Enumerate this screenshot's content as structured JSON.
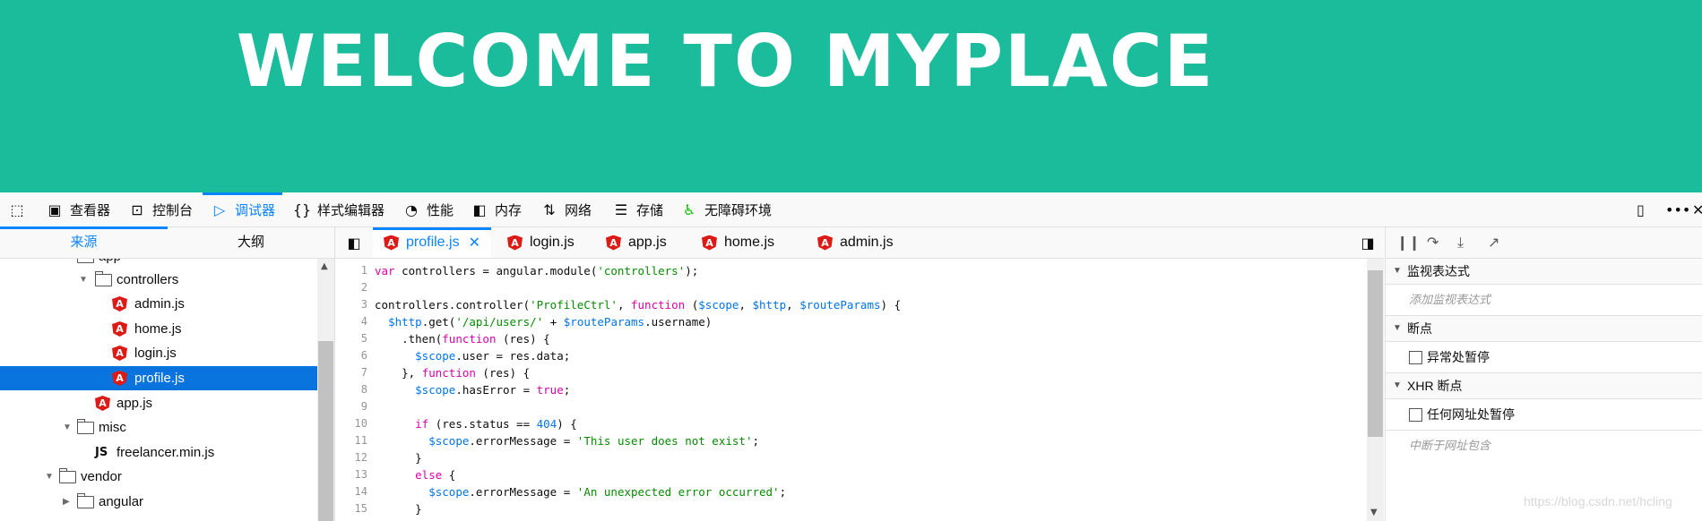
{
  "banner": {
    "title": "WELCOME TO MYPLACE"
  },
  "colors": {
    "banner_bg": "#1abc9c",
    "accent": "#0a84ff",
    "selection": "#0a74de"
  },
  "toolbar": {
    "items": [
      {
        "label": "查看器",
        "icon": "inspector-icon"
      },
      {
        "label": "控制台",
        "icon": "console-icon"
      },
      {
        "label": "调试器",
        "icon": "debugger-icon",
        "active": true
      },
      {
        "label": "样式编辑器",
        "icon": "style-editor-icon"
      },
      {
        "label": "性能",
        "icon": "performance-icon"
      },
      {
        "label": "内存",
        "icon": "memory-icon"
      },
      {
        "label": "网络",
        "icon": "network-icon"
      },
      {
        "label": "存储",
        "icon": "storage-icon"
      },
      {
        "label": "无障碍环境",
        "icon": "accessibility-icon"
      }
    ]
  },
  "sources": {
    "tabs": [
      "来源",
      "大纲"
    ],
    "tree": [
      {
        "label": "app",
        "type": "folder",
        "open": true
      },
      {
        "label": "controllers",
        "type": "folder",
        "open": true
      },
      {
        "label": "admin.js",
        "type": "angular"
      },
      {
        "label": "home.js",
        "type": "angular"
      },
      {
        "label": "login.js",
        "type": "angular"
      },
      {
        "label": "profile.js",
        "type": "angular",
        "selected": true
      },
      {
        "label": "app.js",
        "type": "angular"
      },
      {
        "label": "misc",
        "type": "folder",
        "open": true
      },
      {
        "label": "freelancer.min.js",
        "type": "js",
        "icon_text": "JS"
      },
      {
        "label": "vendor",
        "type": "folder",
        "open": true
      },
      {
        "label": "angular",
        "type": "folder",
        "open": false
      }
    ]
  },
  "editor": {
    "tabs": [
      {
        "label": "profile.js",
        "active": true,
        "close": "✕"
      },
      {
        "label": "login.js"
      },
      {
        "label": "app.js"
      },
      {
        "label": "home.js"
      },
      {
        "label": "admin.js"
      }
    ],
    "line_numbers": [
      "1",
      "2",
      "3",
      "4",
      "5",
      "6",
      "7",
      "8",
      "9",
      "10",
      "11",
      "12",
      "13",
      "14",
      "15"
    ],
    "code": [
      "var controllers = angular.module('controllers');",
      "",
      "controllers.controller('ProfileCtrl', function ($scope, $http, $routeParams) {",
      "  $http.get('/api/users/' + $routeParams.username)",
      "    .then(function (res) {",
      "      $scope.user = res.data;",
      "    }, function (res) {",
      "      $scope.hasError = true;",
      "",
      "      if (res.status == 404) {",
      "        $scope.errorMessage = 'This user does not exist';",
      "      }",
      "      else {",
      "        $scope.errorMessage = 'An unexpected error occurred';",
      "      }"
    ]
  },
  "side_panel": {
    "sections": {
      "watch": {
        "title": "监视表达式",
        "placeholder": "添加监视表达式"
      },
      "breakpoints": {
        "title": "断点",
        "pause_exceptions": "异常处暂停"
      },
      "xhr": {
        "title": "XHR 断点",
        "any_url": "任何网址处暂停",
        "placeholder": "中断于网址包含"
      }
    }
  },
  "watermark": "https://blog.csdn.net/hcling"
}
